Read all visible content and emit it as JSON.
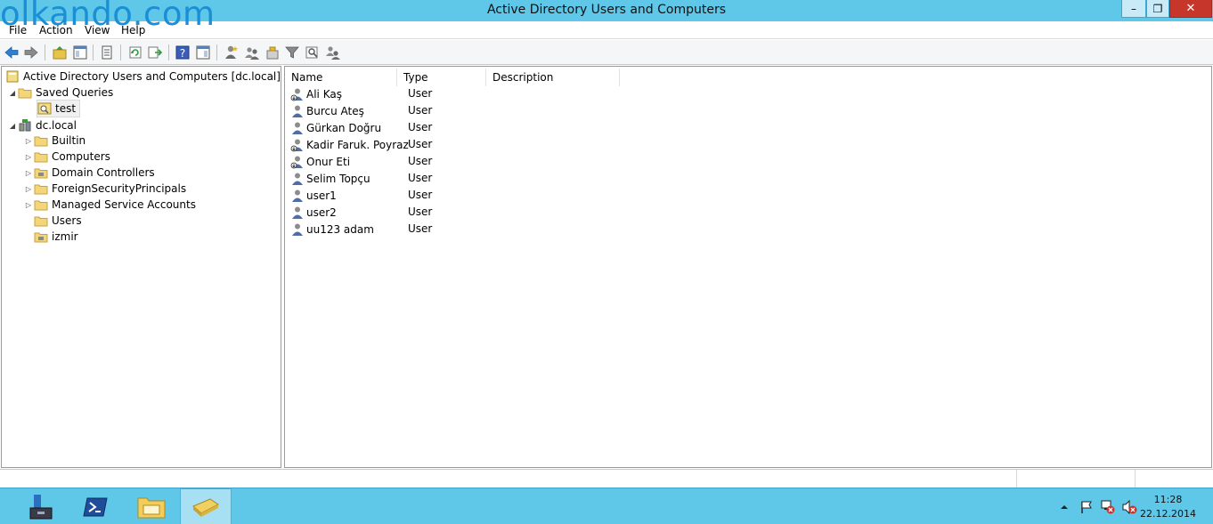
{
  "window": {
    "title": "Active Directory Users and Computers",
    "watermark": "olkando.com",
    "min_glyph": "–",
    "max_glyph": "❐",
    "close_glyph": "✕"
  },
  "menu": [
    "File",
    "Action",
    "View",
    "Help"
  ],
  "toolbar": {
    "icons": [
      "back-icon",
      "forward-icon",
      "up-folder-icon",
      "show-hide-tree-icon",
      "properties-icon",
      "refresh-icon",
      "export-list-icon",
      "help-icon",
      "mmc-view-icon",
      "new-user-icon",
      "new-group-icon",
      "new-ou-icon",
      "filter-icon",
      "find-icon",
      "add-to-group-icon"
    ]
  },
  "tree": {
    "root": "Active Directory Users and Computers [dc.local]",
    "saved_queries": "Saved Queries",
    "query_test": "test",
    "domain": "dc.local",
    "children": [
      "Builtin",
      "Computers",
      "Domain Controllers",
      "ForeignSecurityPrincipals",
      "Managed Service Accounts",
      "Users",
      "izmir"
    ]
  },
  "list": {
    "columns": [
      "Name",
      "Type",
      "Description"
    ],
    "rows": [
      {
        "name": "Ali Kaş",
        "type": "User",
        "disabled": true
      },
      {
        "name": "Burcu Ateş",
        "type": "User",
        "disabled": false
      },
      {
        "name": "Gürkan Doğru",
        "type": "User",
        "disabled": false
      },
      {
        "name": "Kadir Faruk. Poyraz",
        "type": "User",
        "disabled": true
      },
      {
        "name": "Onur Eti",
        "type": "User",
        "disabled": true
      },
      {
        "name": "Selim Topçu",
        "type": "User",
        "disabled": false
      },
      {
        "name": "user1",
        "type": "User",
        "disabled": false
      },
      {
        "name": "user2",
        "type": "User",
        "disabled": false
      },
      {
        "name": "uu123 adam",
        "type": "User",
        "disabled": false
      }
    ]
  },
  "taskbar": {
    "apps": [
      "server-manager-icon",
      "powershell-icon",
      "file-explorer-icon",
      "ad-users-computers-icon"
    ],
    "tray": [
      "show-hidden-icons-icon",
      "action-center-flag-icon",
      "network-icon",
      "volume-muted-icon"
    ],
    "time": "11:28",
    "date": "22.12.2014"
  },
  "colors": {
    "titlebar": "#5fc7e8",
    "close": "#c7362b",
    "watermark": "#1a8fd8"
  }
}
